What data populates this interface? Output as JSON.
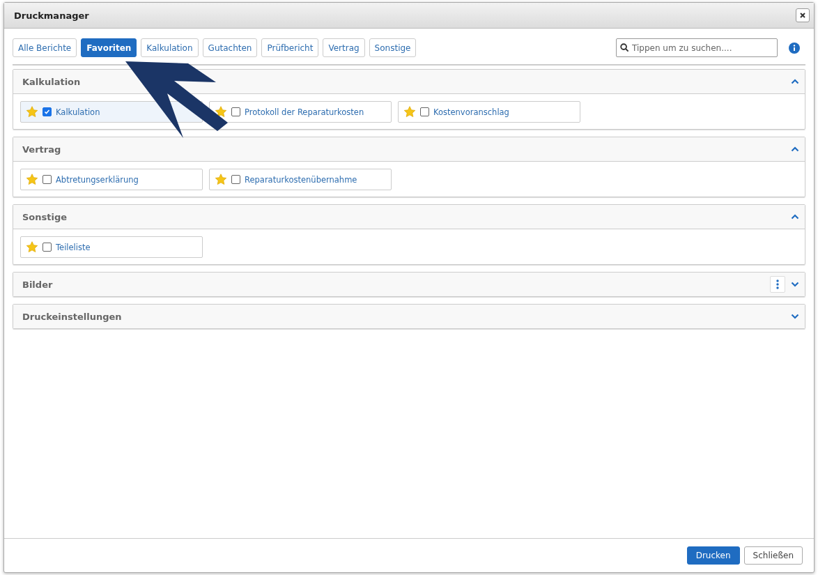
{
  "window": {
    "title": "Druckmanager"
  },
  "tabs": [
    {
      "label": "Alle Berichte",
      "selected": false
    },
    {
      "label": "Favoriten",
      "selected": true
    },
    {
      "label": "Kalkulation",
      "selected": false
    },
    {
      "label": "Gutachten",
      "selected": false
    },
    {
      "label": "Prüfbericht",
      "selected": false
    },
    {
      "label": "Vertrag",
      "selected": false
    },
    {
      "label": "Sonstige",
      "selected": false
    }
  ],
  "search": {
    "placeholder": "Tippen um zu suchen...."
  },
  "sections": [
    {
      "title": "Kalkulation",
      "expanded": true,
      "menu": false,
      "items": [
        {
          "label": "Kalkulation",
          "favorite": true,
          "checked": true
        },
        {
          "label": "Protokoll der Reparaturkosten",
          "favorite": true,
          "checked": false
        },
        {
          "label": "Kostenvoranschlag",
          "favorite": true,
          "checked": false
        }
      ]
    },
    {
      "title": "Vertrag",
      "expanded": true,
      "menu": false,
      "items": [
        {
          "label": "Abtretungserklärung",
          "favorite": true,
          "checked": false
        },
        {
          "label": "Reparaturkostenübernahme",
          "favorite": true,
          "checked": false
        }
      ]
    },
    {
      "title": "Sonstige",
      "expanded": true,
      "menu": false,
      "items": [
        {
          "label": "Teileliste",
          "favorite": true,
          "checked": false
        }
      ]
    },
    {
      "title": "Bilder",
      "expanded": false,
      "menu": true
    },
    {
      "title": "Druckeinstellungen",
      "expanded": false,
      "menu": false
    }
  ],
  "buttons": [
    {
      "label": "Drucken",
      "kind": "primary"
    },
    {
      "label": "Schließen",
      "kind": "secondary"
    }
  ]
}
